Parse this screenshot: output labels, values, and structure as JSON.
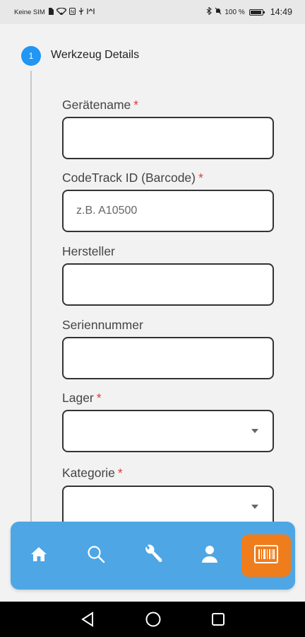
{
  "status_bar": {
    "carrier": "Keine SIM",
    "battery": "100 %",
    "battery_level": 1.0,
    "time": "14:49"
  },
  "stepper": {
    "step_number": "1",
    "title": "Werkzeug Details"
  },
  "form": {
    "fields": [
      {
        "label": "Gerätename",
        "required_mark": "*",
        "value": "",
        "placeholder": ""
      },
      {
        "label": "CodeTrack ID (Barcode)",
        "required_mark": "*",
        "value": "",
        "placeholder": "z.B. A10500"
      },
      {
        "label": "Hersteller",
        "required_mark": "",
        "value": "",
        "placeholder": ""
      },
      {
        "label": "Seriennummer",
        "required_mark": "",
        "value": "",
        "placeholder": ""
      },
      {
        "label": "Lager",
        "required_mark": "*",
        "value": "",
        "type": "select"
      },
      {
        "label": "Kategorie",
        "required_mark": "*",
        "value": "",
        "type": "select"
      }
    ]
  },
  "bottom_nav": {
    "items": [
      {
        "icon": "home-icon",
        "active": false
      },
      {
        "icon": "search-icon",
        "active": false
      },
      {
        "icon": "wrench-icon",
        "active": false
      },
      {
        "icon": "user-icon",
        "active": false
      },
      {
        "icon": "barcode-icon",
        "active": true
      }
    ],
    "colors": {
      "bar": "#4ea6e4",
      "active": "#f07d1c"
    }
  },
  "system_nav": {
    "icons": [
      "back-icon",
      "home-circle-icon",
      "recents-icon"
    ]
  }
}
